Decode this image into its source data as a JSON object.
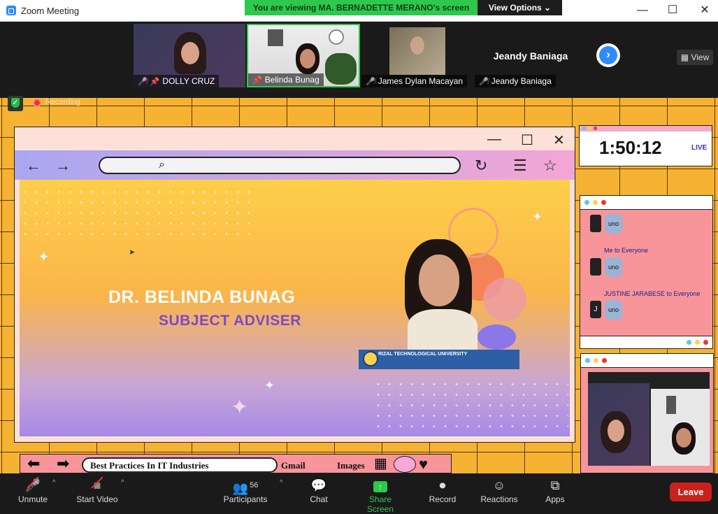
{
  "window": {
    "title": "Zoom Meeting",
    "minimize": "—",
    "maximize": "☐",
    "close": "✕"
  },
  "banner": {
    "viewing": "You are viewing MA. BERNADETTE MERANO's screen",
    "view_options": "View Options ⌄"
  },
  "participants": [
    {
      "name": "DOLLY CRUZ"
    },
    {
      "name": "Belinda Bunag"
    },
    {
      "name": "James Dylan Macayan"
    },
    {
      "name": "Jeandy Baniaga",
      "display": "Jeandy Baniaga"
    }
  ],
  "view_button": "View",
  "recording": "Recording",
  "slide": {
    "name": "DR. BELINDA BUNAG",
    "role": "SUBJECT ADVISER",
    "university": "RIZAL TECHNOLOGICAL UNIVERSITY"
  },
  "timer": {
    "time": "1:50:12",
    "live": "LIVE"
  },
  "chat": {
    "messages": [
      {
        "from": "",
        "text": "uno"
      },
      {
        "from": "Me to Everyone",
        "text": "uno"
      },
      {
        "from": "JUSTINE JARABESE to Everyone",
        "text": "uno"
      }
    ],
    "initial": "J"
  },
  "bottom_strip": {
    "title": "Best Practices In IT Industries",
    "gmail": "Gmail",
    "images": "Images"
  },
  "toolbar": {
    "unmute": "Unmute",
    "start_video": "Start Video",
    "participants": "Participants",
    "participant_count": "56",
    "chat": "Chat",
    "share_screen": "Share Screen",
    "record": "Record",
    "reactions": "Reactions",
    "apps": "Apps",
    "leave": "Leave"
  },
  "colors": {
    "share_green": "#2dc84d",
    "accent_blue": "#2d8cff",
    "leave_red": "#c9221c",
    "slide_orange": "#f6b233"
  }
}
